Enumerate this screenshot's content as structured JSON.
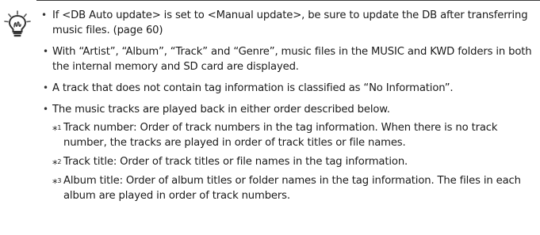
{
  "notes": [
    "If <DB Auto update> is set to <Manual update>, be sure to update the DB after transferring music files. (page 60)",
    "With “Artist”, “Album”, “Track” and “Genre”, music files in the MUSIC and KWD folders in both the internal memory and SD card are displayed.",
    "A track that does not contain tag information is classified as “No Information”.",
    "The music tracks are played back in either order described below."
  ],
  "order_rules": [
    {
      "marker": "*",
      "number": "1",
      "text": "Track number: Order of track numbers in the tag information. When there is no track number, the tracks are played in order of track titles or file names."
    },
    {
      "marker": "*",
      "number": "2",
      "text": "Track title: Order of track titles or file names in the tag information."
    },
    {
      "marker": "*",
      "number": "3",
      "text": "Album title: Order of album titles or folder names in the tag information. The files in each album are played in order of track numbers."
    }
  ]
}
